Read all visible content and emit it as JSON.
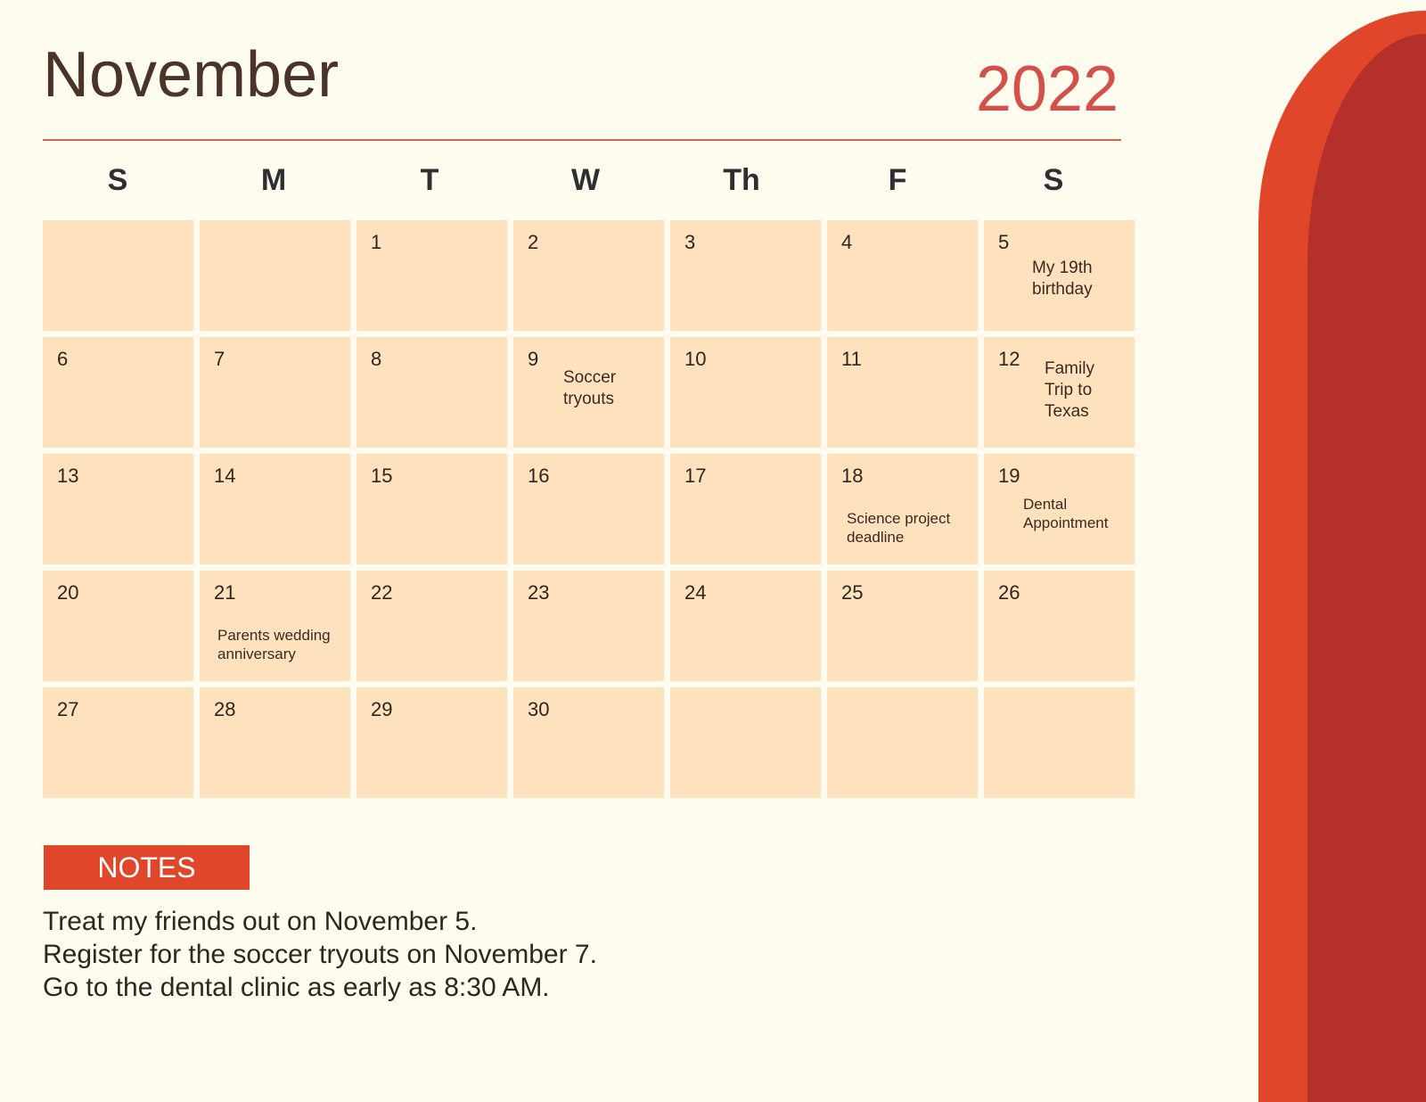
{
  "header": {
    "month": "November",
    "year": "2022"
  },
  "weekdays": [
    "S",
    "M",
    "T",
    "W",
    "Th",
    "F",
    "S"
  ],
  "calendar": {
    "cells": [
      {
        "day": "",
        "event": ""
      },
      {
        "day": "",
        "event": ""
      },
      {
        "day": "1",
        "event": ""
      },
      {
        "day": "2",
        "event": ""
      },
      {
        "day": "3",
        "event": ""
      },
      {
        "day": "4",
        "event": ""
      },
      {
        "day": "5",
        "event": "My 19th birthday"
      },
      {
        "day": "6",
        "event": ""
      },
      {
        "day": "7",
        "event": ""
      },
      {
        "day": "8",
        "event": ""
      },
      {
        "day": "9",
        "event": "Soccer tryouts"
      },
      {
        "day": "10",
        "event": ""
      },
      {
        "day": "11",
        "event": ""
      },
      {
        "day": "12",
        "event": "Family Trip to Texas"
      },
      {
        "day": "13",
        "event": ""
      },
      {
        "day": "14",
        "event": ""
      },
      {
        "day": "15",
        "event": ""
      },
      {
        "day": "16",
        "event": ""
      },
      {
        "day": "17",
        "event": ""
      },
      {
        "day": "18",
        "event": "Science project deadline"
      },
      {
        "day": "19",
        "event": "Dental Appointment"
      },
      {
        "day": "20",
        "event": ""
      },
      {
        "day": "21",
        "event": "Parents wedding anniversary"
      },
      {
        "day": "22",
        "event": ""
      },
      {
        "day": "23",
        "event": ""
      },
      {
        "day": "24",
        "event": ""
      },
      {
        "day": "25",
        "event": ""
      },
      {
        "day": "26",
        "event": ""
      },
      {
        "day": "27",
        "event": ""
      },
      {
        "day": "28",
        "event": ""
      },
      {
        "day": "29",
        "event": ""
      },
      {
        "day": "30",
        "event": ""
      },
      {
        "day": "",
        "event": ""
      },
      {
        "day": "",
        "event": ""
      },
      {
        "day": "",
        "event": ""
      }
    ]
  },
  "notes": {
    "label": "NOTES",
    "lines": [
      "Treat my friends out on November 5.",
      "Register for the soccer  tryouts on November 7.",
      "Go to the dental clinic as early as 8:30 AM."
    ]
  },
  "colors": {
    "background": "#fefbef",
    "cell": "#fde2bd",
    "accent_orange": "#e04629",
    "accent_red": "#b52f2b",
    "year": "#d4504a"
  }
}
